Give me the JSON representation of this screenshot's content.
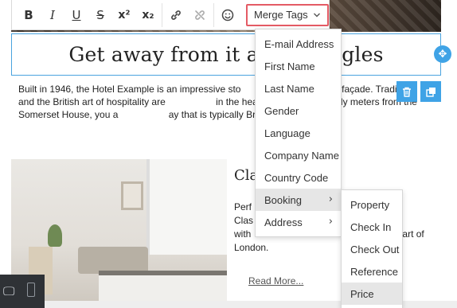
{
  "toolbar": {
    "buttons": [
      {
        "name": "bold-button",
        "icon": "bold-icon",
        "glyph": "B"
      },
      {
        "name": "italic-button",
        "icon": "italic-icon",
        "glyph": "I"
      },
      {
        "name": "underline-button",
        "icon": "underline-icon",
        "glyph": "U"
      },
      {
        "name": "strikethrough-button",
        "icon": "strikethrough-icon",
        "glyph": "S"
      },
      {
        "name": "superscript-button",
        "icon": "superscript-icon",
        "glyph": "x²"
      },
      {
        "name": "subscript-button",
        "icon": "subscript-icon",
        "glyph": "x₂"
      },
      {
        "name": "link-button",
        "icon": "link-icon",
        "glyph": "🔗"
      },
      {
        "name": "unlink-button",
        "icon": "unlink-icon",
        "glyph": "⛓"
      },
      {
        "name": "emoji-button",
        "icon": "smiley-icon",
        "glyph": "☺"
      }
    ],
    "merge_tags_label": "Merge Tags",
    "merge_tags_chevron": "⌄"
  },
  "hero": {
    "title": "Get away from it all",
    "title_tail": "gles"
  },
  "intro": {
    "text": "Built in 1946, the Hotel Example is an impressive sto                  ntricately sc façade. Tradition and the British art of hospitality are                   in the heart of the London, only meters from the Somerset House, you a                   ay that is typically British life."
  },
  "section": {
    "title": "Cla",
    "text": "Perf                                   r the Clas                                   ated with                                   treat in the heart of London.",
    "read_more": "Read More..."
  },
  "merge_menu": {
    "items": [
      {
        "label": "E-mail Address"
      },
      {
        "label": "First Name"
      },
      {
        "label": "Last Name"
      },
      {
        "label": "Gender"
      },
      {
        "label": "Language"
      },
      {
        "label": "Company Name"
      },
      {
        "label": "Country Code"
      },
      {
        "label": "Booking",
        "submenu": true,
        "active": true
      },
      {
        "label": "Address",
        "submenu": true
      }
    ]
  },
  "booking_menu": {
    "items": [
      {
        "label": "Property"
      },
      {
        "label": "Check In"
      },
      {
        "label": "Check Out"
      },
      {
        "label": "Reference"
      },
      {
        "label": "Price",
        "active": true
      }
    ]
  },
  "icons": {
    "move": "move-arrows-icon",
    "delete": "trash-icon",
    "duplicate": "duplicate-icon",
    "desktop": "desktop-icon",
    "mobile": "mobile-icon",
    "chevron_right": "›"
  },
  "colors": {
    "accent": "#3fa3e6",
    "merge_border": "#e45b65",
    "menu_active": "#e6e6e6"
  }
}
